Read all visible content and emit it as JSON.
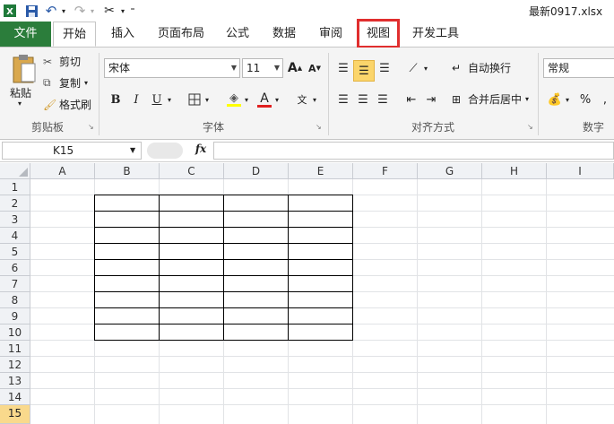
{
  "title_bar": {
    "filename": "最新0917.xlsx",
    "app_icon": "excel-icon"
  },
  "tabs": [
    "文件",
    "开始",
    "插入",
    "页面布局",
    "公式",
    "数据",
    "审阅",
    "视图",
    "开发工具"
  ],
  "clipboard": {
    "paste": "粘贴",
    "cut": "剪切",
    "copy": "复制",
    "format_painter": "格式刷",
    "label": "剪贴板"
  },
  "font": {
    "name": "宋体",
    "size": "11",
    "bold": "B",
    "italic": "I",
    "underline": "U",
    "grow": "A",
    "shrink": "A",
    "label": "字体"
  },
  "alignment": {
    "wrap": "自动换行",
    "merge": "合并后居中",
    "label": "对齐方式"
  },
  "number": {
    "format": "常规",
    "percent": "%",
    "label": "数字"
  },
  "formula_bar": {
    "name_box": "K15",
    "fx": "fx",
    "formula": ""
  },
  "sheet": {
    "columns": [
      "A",
      "B",
      "C",
      "D",
      "E",
      "F",
      "G",
      "H",
      "I"
    ],
    "rows": [
      "1",
      "2",
      "3",
      "4",
      "5",
      "6",
      "7",
      "8",
      "9",
      "10",
      "11",
      "12",
      "13",
      "14",
      "15"
    ],
    "selected_row": "15"
  },
  "colors": {
    "file_tab": "#2b7d3b",
    "highlight": "#e02e2e",
    "selected_row": "#f9d98c"
  }
}
